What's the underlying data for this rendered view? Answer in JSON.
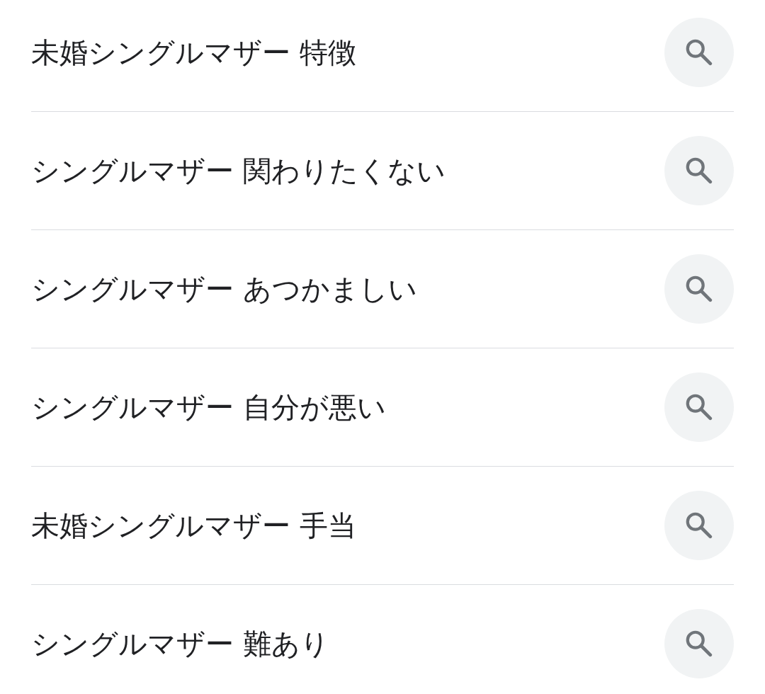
{
  "suggestions": [
    {
      "text": "未婚シングルマザー 特徴"
    },
    {
      "text": "シングルマザー 関わりたくない"
    },
    {
      "text": "シングルマザー あつかましい"
    },
    {
      "text": "シングルマザー 自分が悪い"
    },
    {
      "text": "未婚シングルマザー 手当"
    },
    {
      "text": "シングルマザー 難あり"
    }
  ]
}
